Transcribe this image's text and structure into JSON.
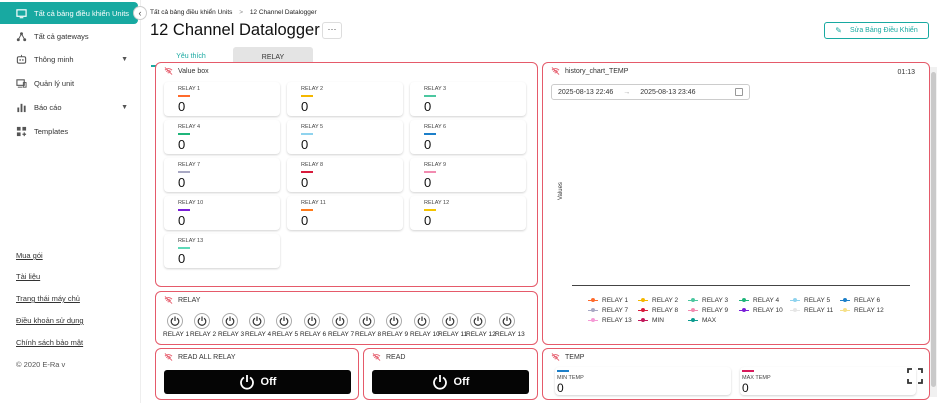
{
  "sidebar": {
    "items": [
      {
        "label": "Tất cả bảng điều khiển Units",
        "icon": "dashboard-icon",
        "active": true
      },
      {
        "label": "Tất cả gateways",
        "icon": "gateway-icon"
      },
      {
        "label": "Thông minh",
        "icon": "automation-icon",
        "has_chevron": true
      },
      {
        "label": "Quản lý unit",
        "icon": "unit-icon"
      },
      {
        "label": "Báo cáo",
        "icon": "report-icon",
        "has_chevron": true
      },
      {
        "label": "Templates",
        "icon": "templates-icon"
      }
    ],
    "footer_links": [
      "Mua gói",
      "Tài liệu",
      "Trang thái máy chủ",
      "Điều khoản sử dụng",
      "Chính sách bảo mật"
    ],
    "copyright": "© 2020 E-Ra v",
    "collapse_glyph": "‹"
  },
  "header": {
    "breadcrumb": [
      "Tất cả bảng điều khiển Units",
      "12 Channel Datalogger"
    ],
    "breadcrumb_sep": ">",
    "title": "12 Channel Datalogger",
    "more_glyph": "···",
    "edit_label": "Sửa Bảng Điều Khiển"
  },
  "tabs": [
    {
      "label": "Yêu thích",
      "active": true
    },
    {
      "label": "RELAY",
      "active": false
    }
  ],
  "value_box": {
    "title": "Value box",
    "items": [
      {
        "label": "RELAY 1",
        "value": "0",
        "color": "#ff6b2c"
      },
      {
        "label": "RELAY 2",
        "value": "0",
        "color": "#f5b800"
      },
      {
        "label": "RELAY 3",
        "value": "0",
        "color": "#4cc7a0"
      },
      {
        "label": "RELAY 4",
        "value": "0",
        "color": "#1fb57a"
      },
      {
        "label": "RELAY 5",
        "value": "0",
        "color": "#8fd3ee"
      },
      {
        "label": "RELAY 6",
        "value": "0",
        "color": "#1c7fc9"
      },
      {
        "label": "RELAY 7",
        "value": "0",
        "color": "#a9a9c4"
      },
      {
        "label": "RELAY 8",
        "value": "0",
        "color": "#d81b3c"
      },
      {
        "label": "RELAY 9",
        "value": "0",
        "color": "#f28bb0"
      },
      {
        "label": "RELAY 10",
        "value": "0",
        "color": "#7a1fd8"
      },
      {
        "label": "RELAY 11",
        "value": "0",
        "color": "#ff7a1a"
      },
      {
        "label": "RELAY 12",
        "value": "0",
        "color": "#f5c400"
      },
      {
        "label": "RELAY 13",
        "value": "0",
        "color": "#5ed9b8"
      }
    ]
  },
  "relay_panel": {
    "title": "RELAY",
    "labels": [
      "RELAY 1",
      "RELAY 2",
      "RELAY 3",
      "RELAY 4",
      "RELAY 5",
      "RELAY 6",
      "RELAY 7",
      "RELAY 8",
      "RELAY 9",
      "RELAY 10",
      "RELAY 11",
      "RELAY 12",
      "RELAY 13"
    ]
  },
  "read_all": {
    "title": "READ ALL RELAY",
    "button_label": "Off"
  },
  "read": {
    "title": "READ",
    "button_label": "Off"
  },
  "history_chart": {
    "title": "history_chart_TEMP",
    "time": "01:13",
    "date_from": "2025-08-13 22:46",
    "date_to": "2025-08-13 23:46",
    "date_arrow": "→",
    "ylabel": "Values"
  },
  "chart_data": {
    "type": "line",
    "title": "history_chart_TEMP",
    "ylabel": "Values",
    "series": [
      {
        "name": "RELAY 1",
        "values": [],
        "color": "#ff6b2c"
      },
      {
        "name": "RELAY 2",
        "values": [],
        "color": "#f5b800"
      },
      {
        "name": "RELAY 3",
        "values": [],
        "color": "#4cc7a0"
      },
      {
        "name": "RELAY 4",
        "values": [],
        "color": "#1fb57a"
      },
      {
        "name": "RELAY 5",
        "values": [],
        "color": "#8fd3ee"
      },
      {
        "name": "RELAY 6",
        "values": [],
        "color": "#1c7fc9"
      },
      {
        "name": "RELAY 7",
        "values": [],
        "color": "#a9a9c4"
      },
      {
        "name": "RELAY 8",
        "values": [],
        "color": "#d81b3c"
      },
      {
        "name": "RELAY 9",
        "values": [],
        "color": "#f28bb0"
      },
      {
        "name": "RELAY 10",
        "values": [],
        "color": "#7a1fd8"
      },
      {
        "name": "RELAY 11",
        "values": [],
        "color": "#e6e6e6"
      },
      {
        "name": "RELAY 12",
        "values": [],
        "color": "#f5e08a"
      },
      {
        "name": "RELAY 13",
        "values": [],
        "color": "#f59bd6"
      },
      {
        "name": "MIN",
        "values": [],
        "color": "#c2185b"
      },
      {
        "name": "MAX",
        "values": [],
        "color": "#0d9b8f"
      }
    ],
    "legend_position": "bottom",
    "grid": false
  },
  "temp": {
    "title": "TEMP",
    "items": [
      {
        "label": "MIN TEMP",
        "value": "0",
        "color": "#1c7fc9"
      },
      {
        "label": "MAX TEMP",
        "value": "0",
        "color": "#d81b5c"
      }
    ]
  },
  "colors": {
    "accent": "#18a9a1",
    "card_border": "#e55a6a"
  }
}
